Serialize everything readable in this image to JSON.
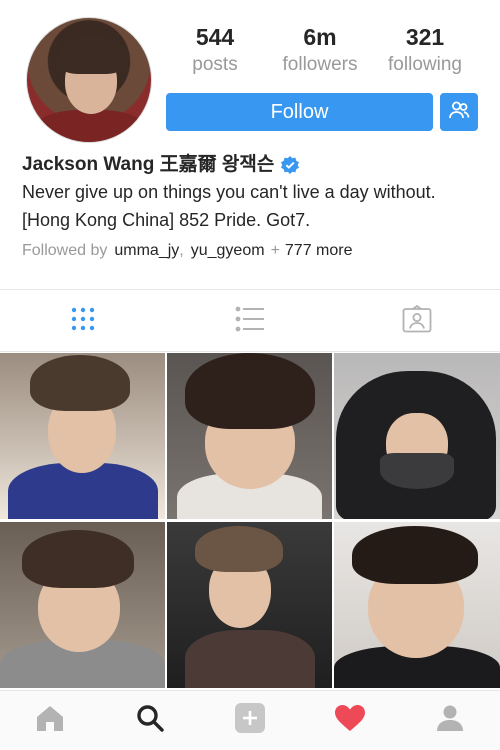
{
  "profile": {
    "name": "Jackson Wang 王嘉爾 왕잭슨",
    "verified": true,
    "bio_lines": [
      "Never give up on things you can't live a day without.",
      "[Hong Kong China] 852 Pride. Got7."
    ],
    "avatar_alt": "profile-photo"
  },
  "stats": [
    {
      "value": "544",
      "label": "posts"
    },
    {
      "value": "6m",
      "label": "followers"
    },
    {
      "value": "321",
      "label": "following"
    }
  ],
  "actions": {
    "follow_label": "Follow",
    "suggest_icon": "add-person-icon"
  },
  "followed_by": {
    "prefix": "Followed by",
    "users": [
      "umma_jy",
      "yu_gyeom"
    ],
    "separator": ",",
    "plus": "+",
    "more": "777 more"
  },
  "view_tabs": [
    {
      "icon": "grid-icon",
      "active": true
    },
    {
      "icon": "list-icon",
      "active": false
    },
    {
      "icon": "tagged-icon",
      "active": false
    }
  ],
  "posts": [
    {
      "icon": "photo"
    },
    {
      "icon": "photo"
    },
    {
      "icon": "photo"
    },
    {
      "icon": "photo"
    },
    {
      "icon": "photo"
    },
    {
      "icon": "photo"
    }
  ],
  "bottom_nav": [
    {
      "icon": "home-icon",
      "active": false
    },
    {
      "icon": "search-icon",
      "active": true
    },
    {
      "icon": "add-post-icon",
      "active": false
    },
    {
      "icon": "heart-icon",
      "active": false
    },
    {
      "icon": "profile-icon",
      "active": false
    }
  ],
  "colors": {
    "accent": "#3897f0",
    "text": "#262626",
    "muted": "#999999",
    "heart": "#ed4956",
    "divider": "#e6e6e6"
  }
}
